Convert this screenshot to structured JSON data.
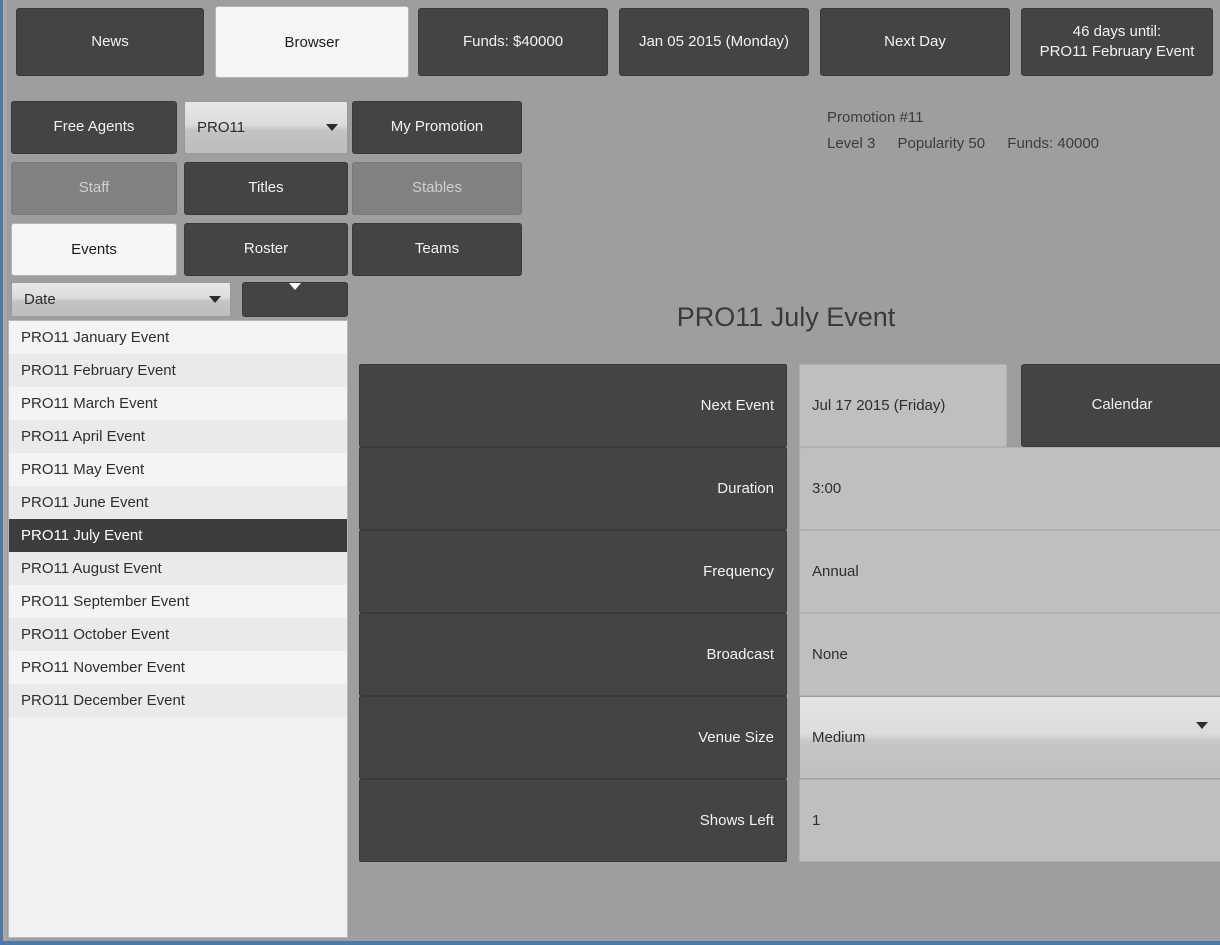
{
  "top_tabs": [
    {
      "label": "News",
      "selected": false
    },
    {
      "label": "Browser",
      "selected": true
    },
    {
      "label": "Funds: $40000",
      "selected": false
    },
    {
      "label": "Jan 05 2015 (Monday)",
      "selected": false
    },
    {
      "label": "Next Day",
      "selected": false
    }
  ],
  "countdown_tab": {
    "line1": "46 days until:",
    "line2": "PRO11 February Event"
  },
  "nav": {
    "free_agents": "Free Agents",
    "promotion_select": "PRO11",
    "my_promotion": "My Promotion",
    "staff": "Staff",
    "titles": "Titles",
    "stables": "Stables",
    "events": "Events",
    "roster": "Roster",
    "teams": "Teams"
  },
  "promotion_info": {
    "name": "Promotion #11",
    "level": "Level 3",
    "popularity": "Popularity 50",
    "funds": "Funds: 40000"
  },
  "sort": {
    "field": "Date",
    "direction_icon": "triangle-down-icon"
  },
  "event_list": [
    {
      "label": "PRO11 January Event",
      "selected": false
    },
    {
      "label": "PRO11 February Event",
      "selected": false
    },
    {
      "label": "PRO11 March Event",
      "selected": false
    },
    {
      "label": "PRO11 April Event",
      "selected": false
    },
    {
      "label": "PRO11 May Event",
      "selected": false
    },
    {
      "label": "PRO11 June Event",
      "selected": false
    },
    {
      "label": "PRO11 July Event",
      "selected": true
    },
    {
      "label": "PRO11 August Event",
      "selected": false
    },
    {
      "label": "PRO11 September Event",
      "selected": false
    },
    {
      "label": "PRO11 October Event",
      "selected": false
    },
    {
      "label": "PRO11 November Event",
      "selected": false
    },
    {
      "label": "PRO11 December Event",
      "selected": false
    }
  ],
  "detail": {
    "title": "PRO11 July Event",
    "next_event": {
      "label": "Next Event",
      "value": "Jul 17 2015 (Friday)",
      "button": "Calendar"
    },
    "duration": {
      "label": "Duration",
      "value": "3:00"
    },
    "frequency": {
      "label": "Frequency",
      "value": "Annual"
    },
    "broadcast": {
      "label": "Broadcast",
      "value": "None"
    },
    "venue_size": {
      "label": "Venue Size",
      "value": "Medium"
    },
    "shows_left": {
      "label": "Shows Left",
      "value": "1"
    }
  },
  "colors": {
    "background": "#9e9e9e",
    "dark_button": "#444444",
    "disabled_button": "#818181",
    "value_field": "#bfbfbf",
    "list_background": "#f4f4f4",
    "selected_row": "#3d3d3d",
    "window_border": "#4a7ba7"
  }
}
